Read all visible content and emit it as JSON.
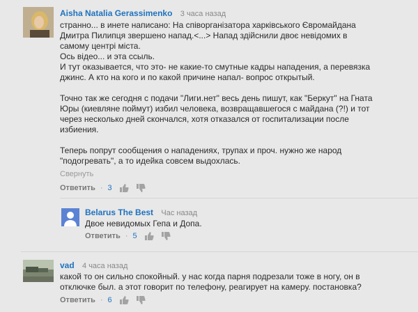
{
  "comments": [
    {
      "author": "Aisha Natalia Gerassimenko",
      "time": "3 часа назад",
      "text": "странно... в инете написано: На співорганізатора харківського Євромайдана\nДмитра Пилипця звершено напад.<...>  Напад здійснили двоє невідомих в\nсамому центрі міста.\nОсь відео... и эта ссыль.\nИ тут оказывается, что это- не какие-то смутные кадры нападения, а перевязка\nджинс. А кто на кого и по какой причине напал- вопрос открытый.\n\nТочно так же сегодня с подачи \"Лиги.нет\" весь день пишут, как \"Беркут\" на Гната\nЮры (киевляне поймут) избил человека, возвращавшегося с майдана (?!) и тот\nчерез несколько дней скончался, хотя отказался от госпитализации после\nизбиения.\n\nТеперь попрут сообщения о нападениях, трупах и проч. нужно же народ\n\"подогревать\", а то идейка совсем выдохлась.",
      "collapse": "Свернуть",
      "reply": "Ответить",
      "likes": "3"
    },
    {
      "author": "Belarus The Best",
      "time": "Час назад",
      "text": "Двое невидомых Гепа и Допа.",
      "reply": "Ответить",
      "likes": "5"
    },
    {
      "author": "vad",
      "time": "4 часа назад",
      "text": "какой то он сильно спокойный. у нас когда парня подрезали тоже в ногу, он в\nотключке был. а этот говорит по телефону, реагирует на камеру. постановка?",
      "reply": "Ответить",
      "likes": "6"
    }
  ],
  "separator": "·",
  "icons": {
    "like": "thumb-up-icon",
    "dislike": "thumb-down-icon"
  },
  "colors": {
    "author": "#1f72bf",
    "background": "#e8e8e8"
  }
}
